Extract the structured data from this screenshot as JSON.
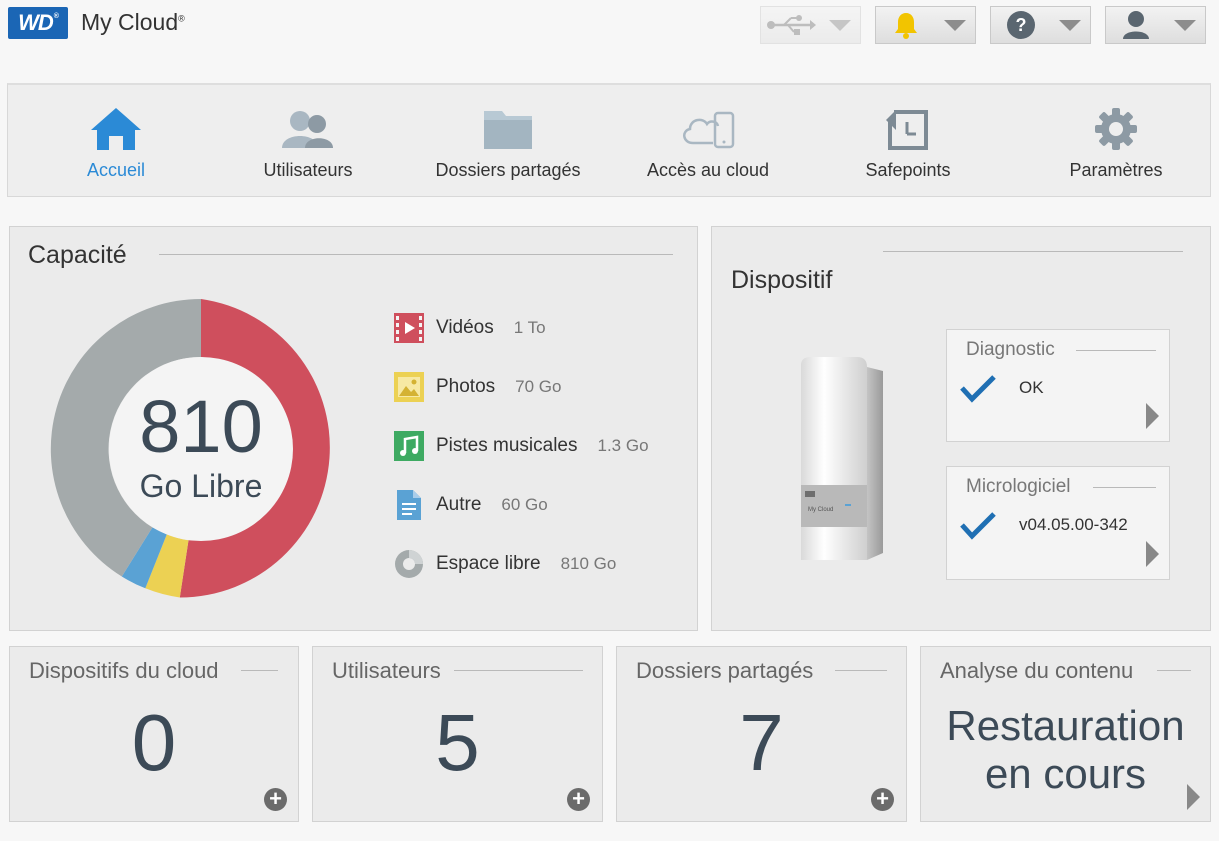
{
  "header": {
    "logo_text": "WD",
    "logo_mark": "®",
    "app_title": "My Cloud",
    "app_title_mark": "®",
    "buttons": [
      {
        "name": "usb-menu-button",
        "icon": "usb-icon",
        "disabled": true
      },
      {
        "name": "alerts-menu-button",
        "icon": "bell-icon"
      },
      {
        "name": "help-menu-button",
        "icon": "help-icon"
      },
      {
        "name": "user-menu-button",
        "icon": "user-icon"
      }
    ]
  },
  "nav": {
    "items": [
      {
        "label": "Accueil",
        "icon": "home-icon",
        "active": true
      },
      {
        "label": "Utilisateurs",
        "icon": "users-icon"
      },
      {
        "label": "Dossiers partagés",
        "icon": "folder-icon"
      },
      {
        "label": "Accès au cloud",
        "icon": "cloud-device-icon"
      },
      {
        "label": "Safepoints",
        "icon": "safepoint-icon"
      },
      {
        "label": "Paramètres",
        "icon": "gear-icon"
      }
    ]
  },
  "capacity": {
    "title": "Capacité",
    "center_value": "810",
    "center_unit": "Go Libre",
    "legend": [
      {
        "label": "Vidéos",
        "value": "1 To",
        "icon": "video-icon",
        "color": "#cf4f5d"
      },
      {
        "label": "Photos",
        "value": "70 Go",
        "icon": "photo-icon",
        "color": "#ecd153"
      },
      {
        "label": "Pistes musicales",
        "value": "1.3 Go",
        "icon": "music-icon",
        "color": "#3eaa62"
      },
      {
        "label": "Autre",
        "value": "60 Go",
        "icon": "document-icon",
        "color": "#5aa2d4"
      },
      {
        "label": "Espace libre",
        "value": "810 Go",
        "icon": "free-space-icon",
        "color": "#a4aaab"
      }
    ]
  },
  "device": {
    "title": "Dispositif",
    "device_label": "My Cloud",
    "diagnostic": {
      "title": "Diagnostic",
      "status": "OK"
    },
    "firmware": {
      "title": "Micrologiciel",
      "status": "v04.05.00-342"
    }
  },
  "cards": [
    {
      "title": "Dispositifs du cloud",
      "value": "0"
    },
    {
      "title": "Utilisateurs",
      "value": "5"
    },
    {
      "title": "Dossiers partagés",
      "value": "7"
    },
    {
      "title": "Analyse du contenu",
      "value_line1": "Restauration",
      "value_line2": "en cours"
    }
  ],
  "colors": {
    "accent": "#2b8ad6",
    "videos": "#cf4f5d",
    "photos": "#ecd153",
    "autre": "#5aa2d4",
    "free": "#a4aaab",
    "check": "#1f6fb3"
  }
}
